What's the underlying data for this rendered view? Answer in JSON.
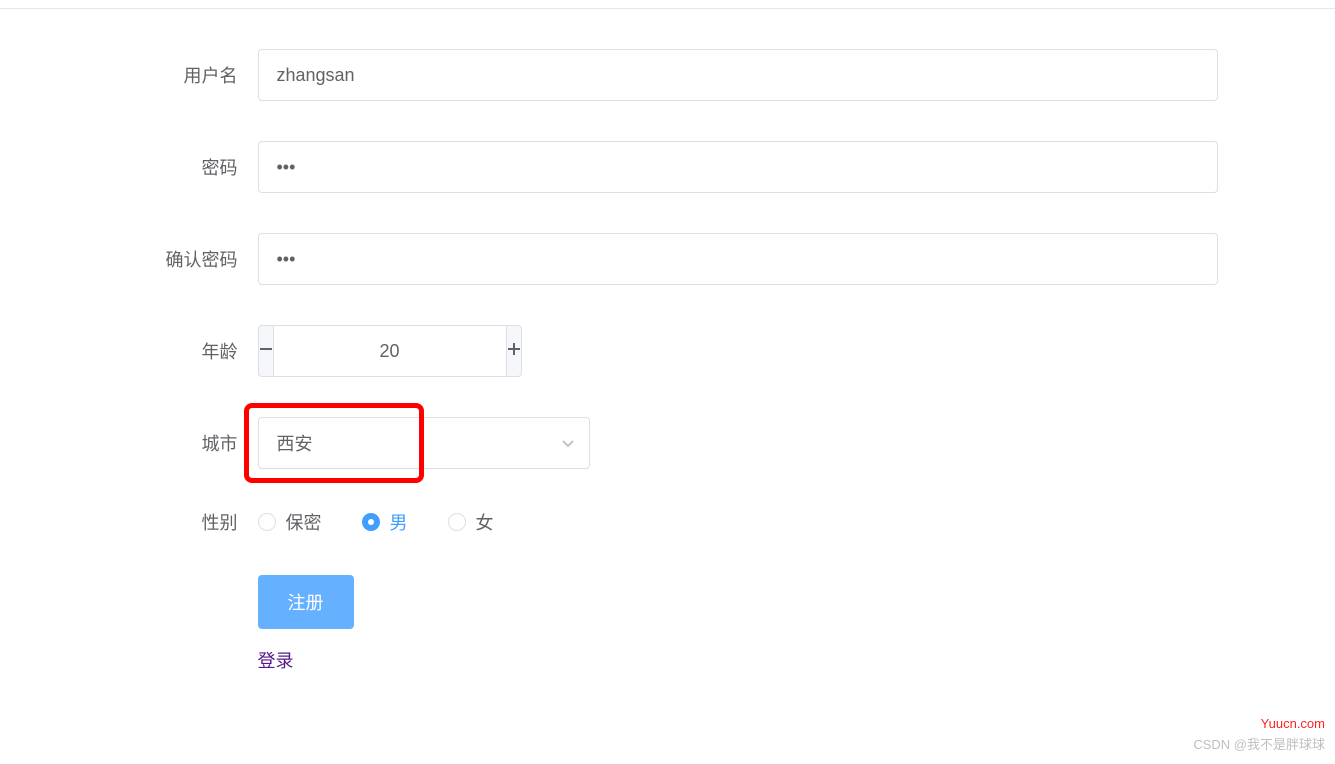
{
  "form": {
    "username": {
      "label": "用户名",
      "value": "zhangsan"
    },
    "password": {
      "label": "密码",
      "value": "•••"
    },
    "confirm_password": {
      "label": "确认密码",
      "value": "•••"
    },
    "age": {
      "label": "年龄",
      "value": "20"
    },
    "city": {
      "label": "城市",
      "value": "西安"
    },
    "gender": {
      "label": "性别",
      "options": [
        {
          "label": "保密",
          "selected": false
        },
        {
          "label": "男",
          "selected": true
        },
        {
          "label": "女",
          "selected": false
        }
      ]
    },
    "submit_label": "注册",
    "login_link": "登录"
  },
  "watermark": {
    "line1": "Yuucn.com",
    "line2": "CSDN @我不是胖球球"
  }
}
